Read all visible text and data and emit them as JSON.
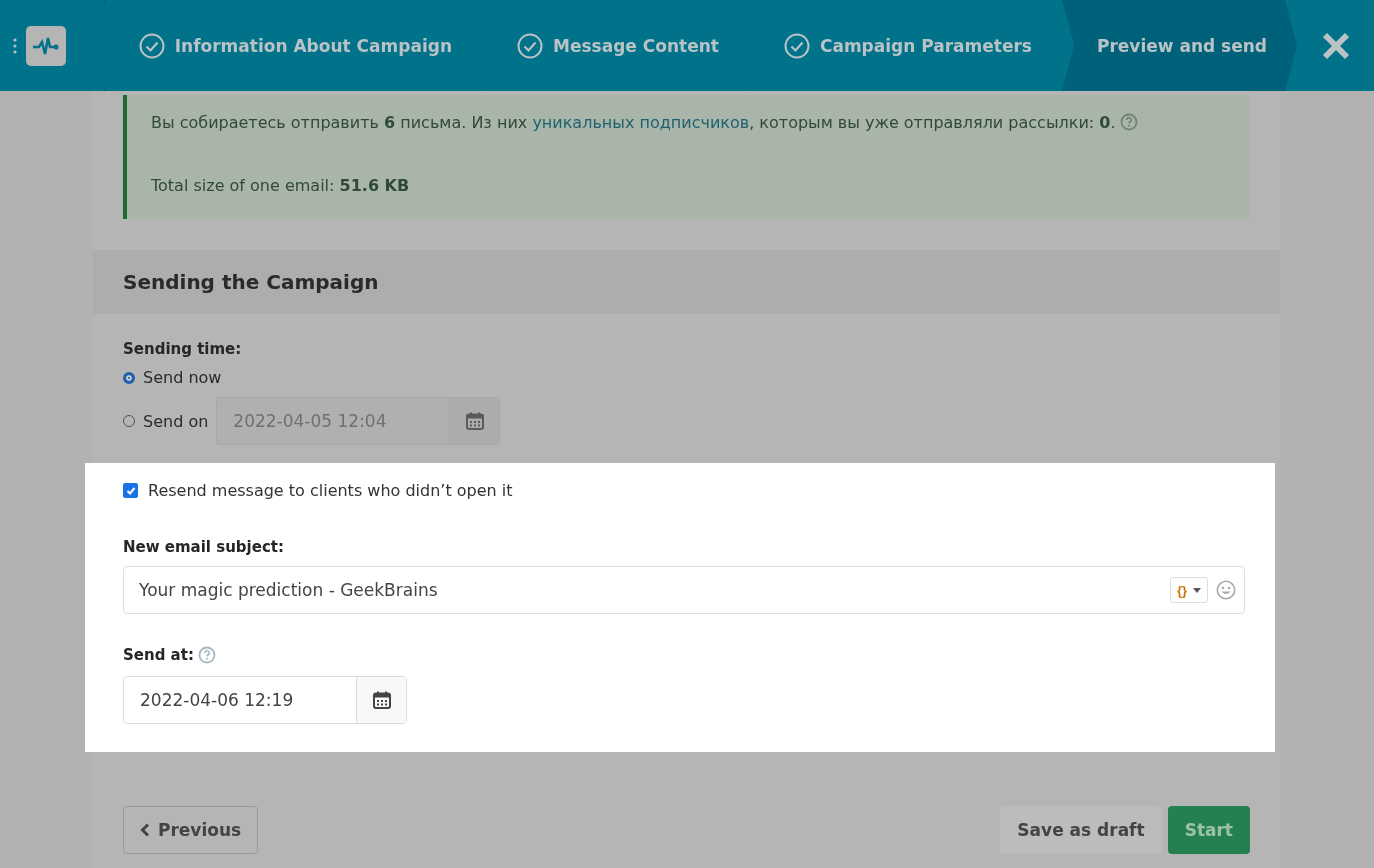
{
  "header": {
    "steps": [
      {
        "label": "Information About Campaign",
        "done": true,
        "selected": false
      },
      {
        "label": "Message Content",
        "done": true,
        "selected": false
      },
      {
        "label": "Campaign Parameters",
        "done": true,
        "selected": false
      },
      {
        "label": "Preview and send",
        "done": false,
        "selected": true
      }
    ]
  },
  "summary": {
    "sentence_start": "Вы собираетесь отправить **6** письма.  Из них ",
    "link": "уникальных подписчиков",
    "sentence_end": ", которым вы уже отправляли рассылки: **0**.",
    "size_text": "Total size of one email: **51.6 KB**"
  },
  "section": {
    "title": "Sending the Campaign",
    "sending_time_label": "Sending time:",
    "options": [
      {
        "label": "Send now",
        "selected": true
      },
      {
        "label": "Send on",
        "selected": false,
        "value": "2022-04-05 12:04"
      }
    ],
    "resend": {
      "label": "Resend message to clients who didn’t open it",
      "checked": true
    },
    "subject_label": "New email subject:",
    "subject_value": "Your magic prediction - GeekBrains",
    "variables_button": "{}",
    "send_at_label": "Send at:",
    "send_at_value": "2022-04-06 12:19"
  },
  "footer": {
    "previous": "Previous",
    "save_draft": "Save as draft",
    "start": "Start"
  }
}
